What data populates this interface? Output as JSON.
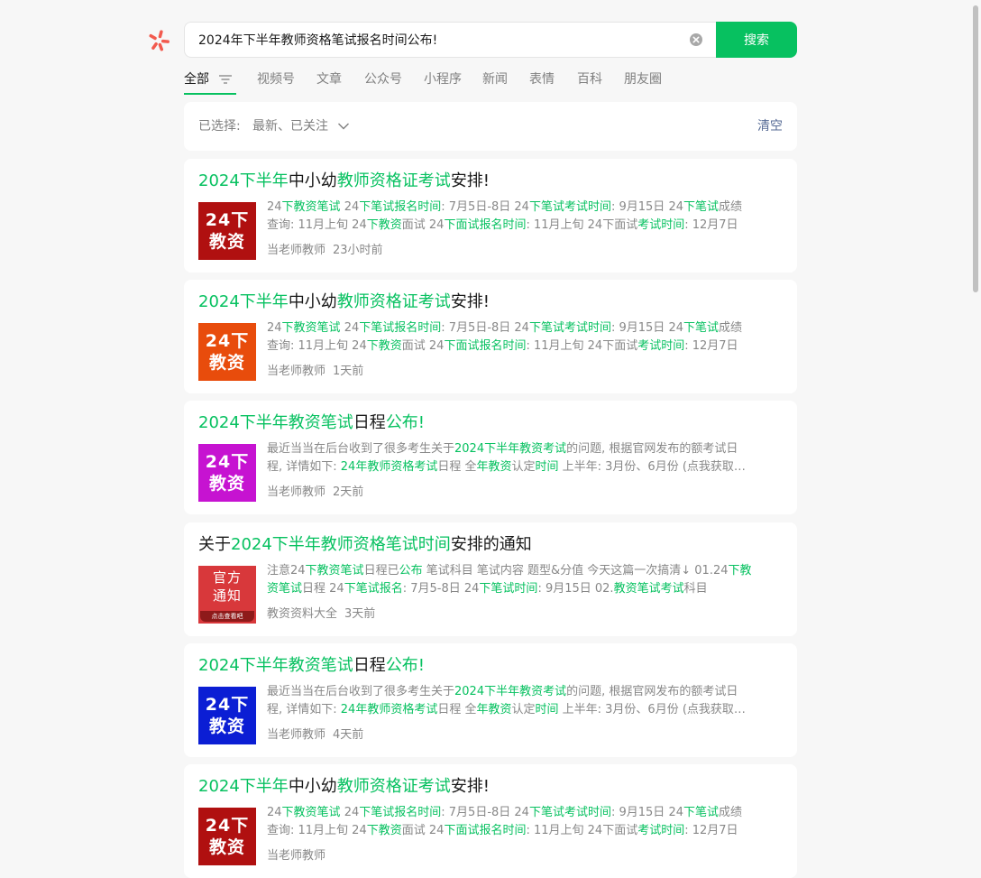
{
  "search": {
    "query": "2024年下半年教师资格笔试报名时间公布!",
    "button_label": "搜索"
  },
  "tabs": [
    "全部",
    "视频号",
    "文章",
    "公众号",
    "小程序",
    "新闻",
    "表情",
    "百科",
    "朋友圈"
  ],
  "filter": {
    "label": "已选择:",
    "values": "最新、已关注",
    "clear_label": "清空"
  },
  "results": [
    {
      "title": [
        [
          "2024下半年",
          true
        ],
        [
          "中小幼",
          false
        ],
        [
          "教师资格证考试",
          true
        ],
        [
          "安排!",
          false
        ]
      ],
      "thumb": {
        "line1": "24下",
        "line2": "教资",
        "bg": "#b01010"
      },
      "snippet_lines": [
        [
          [
            "24",
            false
          ],
          [
            "下教资笔试",
            true
          ],
          [
            " 24",
            false
          ],
          [
            "下笔试报名时间",
            true
          ],
          [
            ": 7月5日-8日 24",
            false
          ],
          [
            "下笔试考试时间",
            true
          ],
          [
            ": 9月15日 24",
            false
          ],
          [
            "下笔试",
            true
          ],
          [
            "成绩",
            false
          ]
        ],
        [
          [
            "查询: 11月上旬 24",
            false
          ],
          [
            "下教资",
            true
          ],
          [
            "面试 24",
            false
          ],
          [
            "下面",
            true
          ],
          [
            "试报名时间",
            true
          ],
          [
            ": 11月上旬 24下面试",
            false
          ],
          [
            "考试时间",
            true
          ],
          [
            ": 12月7日",
            false
          ]
        ]
      ],
      "source": "当老师教师",
      "time": "23小时前"
    },
    {
      "title": [
        [
          "2024下半年",
          true
        ],
        [
          "中小幼",
          false
        ],
        [
          "教师资格证考试",
          true
        ],
        [
          "安排!",
          false
        ]
      ],
      "thumb": {
        "line1": "24下",
        "line2": "教资",
        "bg": "#e84c0c"
      },
      "snippet_lines": [
        [
          [
            "24",
            false
          ],
          [
            "下教资笔试",
            true
          ],
          [
            " 24",
            false
          ],
          [
            "下笔试报名时间",
            true
          ],
          [
            ": 7月5日-8日 24",
            false
          ],
          [
            "下笔试考试时间",
            true
          ],
          [
            ": 9月15日 24",
            false
          ],
          [
            "下笔试",
            true
          ],
          [
            "成绩",
            false
          ]
        ],
        [
          [
            "查询: 11月上旬 24",
            false
          ],
          [
            "下教资",
            true
          ],
          [
            "面试 24",
            false
          ],
          [
            "下面",
            true
          ],
          [
            "试报名时间",
            true
          ],
          [
            ": 11月上旬 24下面试",
            false
          ],
          [
            "考试时间",
            true
          ],
          [
            ": 12月7日",
            false
          ]
        ]
      ],
      "source": "当老师教师",
      "time": "1天前"
    },
    {
      "title": [
        [
          "2024下半年教资笔试",
          true
        ],
        [
          "日程",
          false
        ],
        [
          "公布!",
          true
        ]
      ],
      "thumb": {
        "line1": "24下",
        "line2": "教资",
        "bg": "#c613d1"
      },
      "snippet_lines": [
        [
          [
            "最近当当在后台收到了很多考生关于",
            false
          ],
          [
            "2024下半年教资考试",
            true
          ],
          [
            "的问题, 根据官网发布的额考试日",
            false
          ]
        ],
        [
          [
            "程, 详情如下: ",
            false
          ],
          [
            "24年教师资格考试",
            true
          ],
          [
            "日程 全",
            false
          ],
          [
            "年教资",
            true
          ],
          [
            "认定",
            false
          ],
          [
            "时间",
            true
          ],
          [
            " 上半年: 3月份、6月份 (点我获取…",
            false
          ]
        ]
      ],
      "source": "当老师教师",
      "time": "2天前"
    },
    {
      "title": [
        [
          "关于",
          false
        ],
        [
          "2024下半年教师资格笔试时间",
          true
        ],
        [
          "安排的通知",
          false
        ]
      ],
      "thumb": {
        "line1": "官方",
        "line2": "通知",
        "strip": "点击查看吧",
        "bg": "#d8383b",
        "notice": true
      },
      "snippet_lines": [
        [
          [
            "注意24",
            false
          ],
          [
            "下教资笔试",
            true
          ],
          [
            "日程已",
            false
          ],
          [
            "公布",
            true
          ],
          [
            " 笔试科目 笔试内容 题型&分值 今天这篇一次搞清↓ 01.24",
            false
          ],
          [
            "下教",
            true
          ]
        ],
        [
          [
            "资笔试",
            true
          ],
          [
            "日程 24",
            false
          ],
          [
            "下笔试报名",
            true
          ],
          [
            ": 7月5-8日 24",
            false
          ],
          [
            "下笔试时间",
            true
          ],
          [
            ": 9月15日 02.",
            false
          ],
          [
            "教资笔试考试",
            true
          ],
          [
            "科目",
            false
          ]
        ]
      ],
      "source": "教资资料大全",
      "time": "3天前"
    },
    {
      "title": [
        [
          "2024下半年教资笔试",
          true
        ],
        [
          "日程",
          false
        ],
        [
          "公布!",
          true
        ]
      ],
      "thumb": {
        "line1": "24下",
        "line2": "教资",
        "bg": "#0b1ed4"
      },
      "snippet_lines": [
        [
          [
            "最近当当在后台收到了很多考生关于",
            false
          ],
          [
            "2024下半年教资考试",
            true
          ],
          [
            "的问题, 根据官网发布的额考试日",
            false
          ]
        ],
        [
          [
            "程, 详情如下: ",
            false
          ],
          [
            "24年教师资格考试",
            true
          ],
          [
            "日程 全",
            false
          ],
          [
            "年教资",
            true
          ],
          [
            "认定",
            false
          ],
          [
            "时间",
            true
          ],
          [
            " 上半年: 3月份、6月份 (点我获取…",
            false
          ]
        ]
      ],
      "source": "当老师教师",
      "time": "4天前"
    },
    {
      "title": [
        [
          "2024下半年",
          true
        ],
        [
          "中小幼",
          false
        ],
        [
          "教师资格证考试",
          true
        ],
        [
          "安排!",
          false
        ]
      ],
      "thumb": {
        "line1": "24下",
        "line2": "教资",
        "bg": "#b01010"
      },
      "snippet_lines": [
        [
          [
            "24",
            false
          ],
          [
            "下教资笔试",
            true
          ],
          [
            " 24",
            false
          ],
          [
            "下笔试报名时间",
            true
          ],
          [
            ": 7月5日-8日 24",
            false
          ],
          [
            "下笔试考试时间",
            true
          ],
          [
            ": 9月15日 24",
            false
          ],
          [
            "下笔试",
            true
          ],
          [
            "成绩",
            false
          ]
        ],
        [
          [
            "查询: 11月上旬 24",
            false
          ],
          [
            "下教资",
            true
          ],
          [
            "面试 24",
            false
          ],
          [
            "下面",
            true
          ],
          [
            "试报名时间",
            true
          ],
          [
            ": 11月上旬 24下面试",
            false
          ],
          [
            "考试时间",
            true
          ],
          [
            ": 12月7日",
            false
          ]
        ]
      ],
      "source": "当老师教师",
      "time": ""
    }
  ],
  "colors": {
    "accent": "#07c160",
    "link": "#576b95"
  }
}
